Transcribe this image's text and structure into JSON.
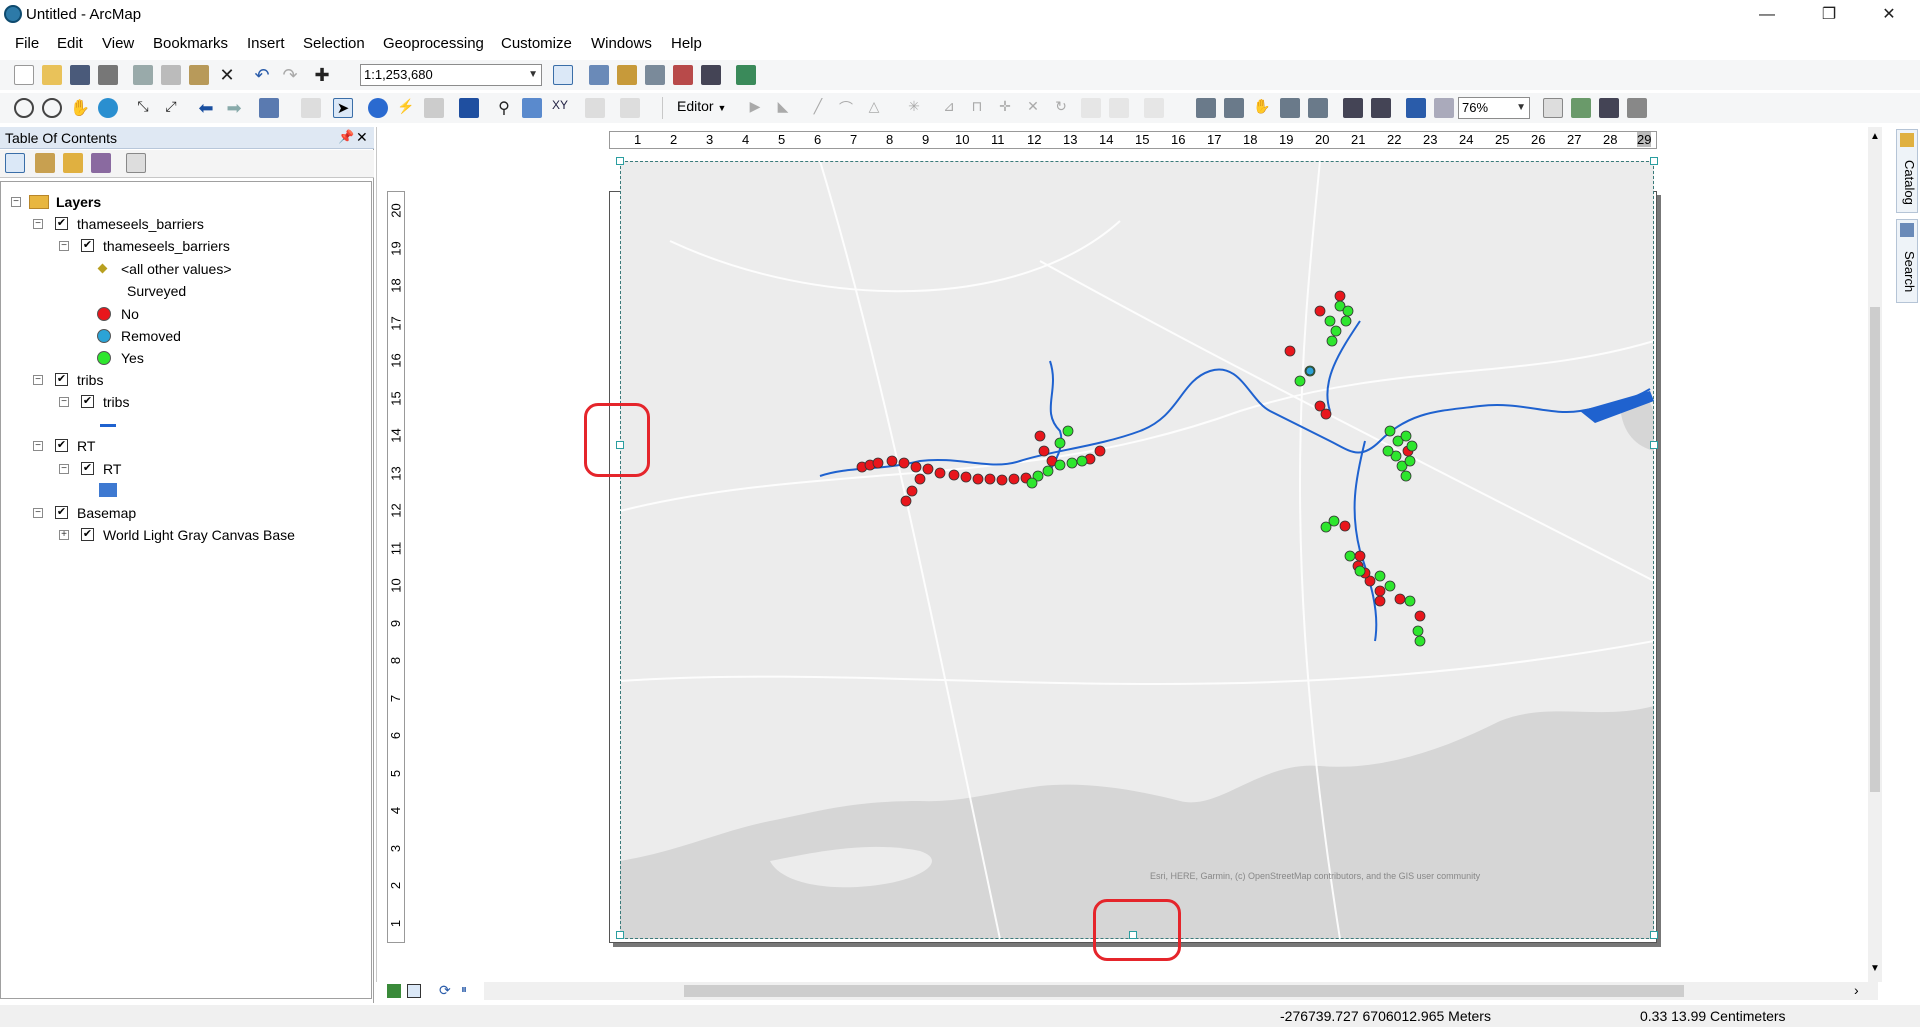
{
  "window": {
    "title": "Untitled - ArcMap",
    "minimize": "—",
    "restore": "❐",
    "close": "✕"
  },
  "menu": [
    "File",
    "Edit",
    "View",
    "Bookmarks",
    "Insert",
    "Selection",
    "Geoprocessing",
    "Customize",
    "Windows",
    "Help"
  ],
  "toolbar": {
    "scale_value": "1:1,253,680",
    "editor_label": "Editor",
    "zoom_value": "76%"
  },
  "toc": {
    "title": "Table Of Contents",
    "pin_icon": "pin-icon",
    "close_icon": "close-icon",
    "root": "Layers",
    "layers": [
      {
        "name": "thameseels_barriers",
        "sub": "thameseels_barriers",
        "legend_header": "<all other values>",
        "field": "Surveyed",
        "classes": [
          {
            "label": "No",
            "color": "#e8161c"
          },
          {
            "label": "Removed",
            "color": "#2ba3d6"
          },
          {
            "label": "Yes",
            "color": "#2ee62e"
          }
        ]
      },
      {
        "name": "tribs",
        "sub": "tribs",
        "line_color": "#1f62cf"
      },
      {
        "name": "RT",
        "sub": "RT",
        "fill_color": "#3e79d1"
      },
      {
        "name": "Basemap",
        "sub": "World Light Gray Canvas Base"
      }
    ]
  },
  "rulers": {
    "horizontal": [
      "1",
      "2",
      "3",
      "4",
      "5",
      "6",
      "7",
      "8",
      "9",
      "10",
      "11",
      "12",
      "13",
      "14",
      "15",
      "16",
      "17",
      "18",
      "19",
      "20",
      "21",
      "22",
      "23",
      "24",
      "25",
      "26",
      "27",
      "28",
      "29"
    ],
    "vertical": [
      "20",
      "19",
      "18",
      "17",
      "16",
      "15",
      "14",
      "13",
      "12",
      "11",
      "10",
      "9",
      "8",
      "7",
      "6",
      "5",
      "4",
      "3",
      "2",
      "1"
    ]
  },
  "map": {
    "attribution": "Esri, HERE, Garmin, (c) OpenStreetMap contributors, and the GIS user community",
    "land_color": "#ececec",
    "sea_color": "#d6d6d6",
    "river_color": "#1f62cf"
  },
  "side_tabs": [
    "Catalog",
    "Search"
  ],
  "status": {
    "coords": "-276739.727  6706012.965 Meters",
    "page_coords": "0.33  13.99 Centimeters"
  }
}
